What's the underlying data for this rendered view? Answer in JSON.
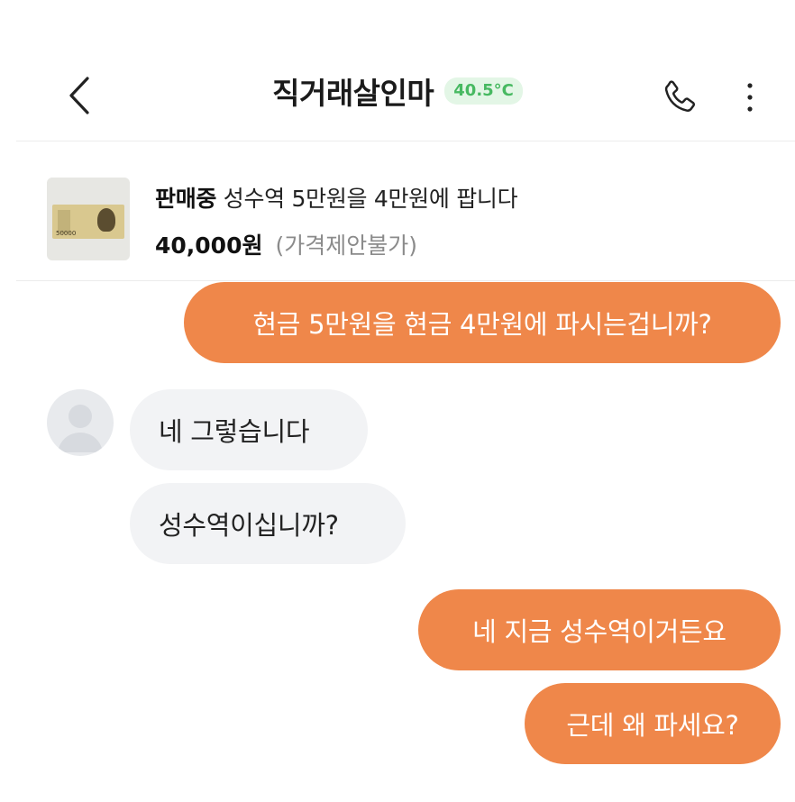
{
  "header": {
    "title": "직거래살인마",
    "temperature": "40.5°C",
    "back_icon": "chevron-left-icon",
    "phone_icon": "phone-icon",
    "more_icon": "more-vertical-icon"
  },
  "product": {
    "status": "판매중",
    "title": "성수역 5만원을 4만원에 팝니다",
    "price": "40,000원",
    "price_note": "(가격제안불가)",
    "thumbnail": "50000-won-banknote",
    "thumbnail_bill_number": "50000"
  },
  "messages": [
    {
      "from": "me",
      "text": "현금 5만원을 현금 4만원에 파시는겁니까?"
    },
    {
      "from": "other",
      "text": "네 그렇습니다"
    },
    {
      "from": "other",
      "text": "성수역이십니까?"
    },
    {
      "from": "me",
      "text": "네 지금 성수역이거든요"
    },
    {
      "from": "me",
      "text": "근데 왜 파세요?"
    }
  ],
  "colors": {
    "sent_bubble": "#ef874a",
    "received_bubble": "#f2f3f5",
    "temperature_text": "#47b961",
    "temperature_bg": "#e3f6e6"
  }
}
